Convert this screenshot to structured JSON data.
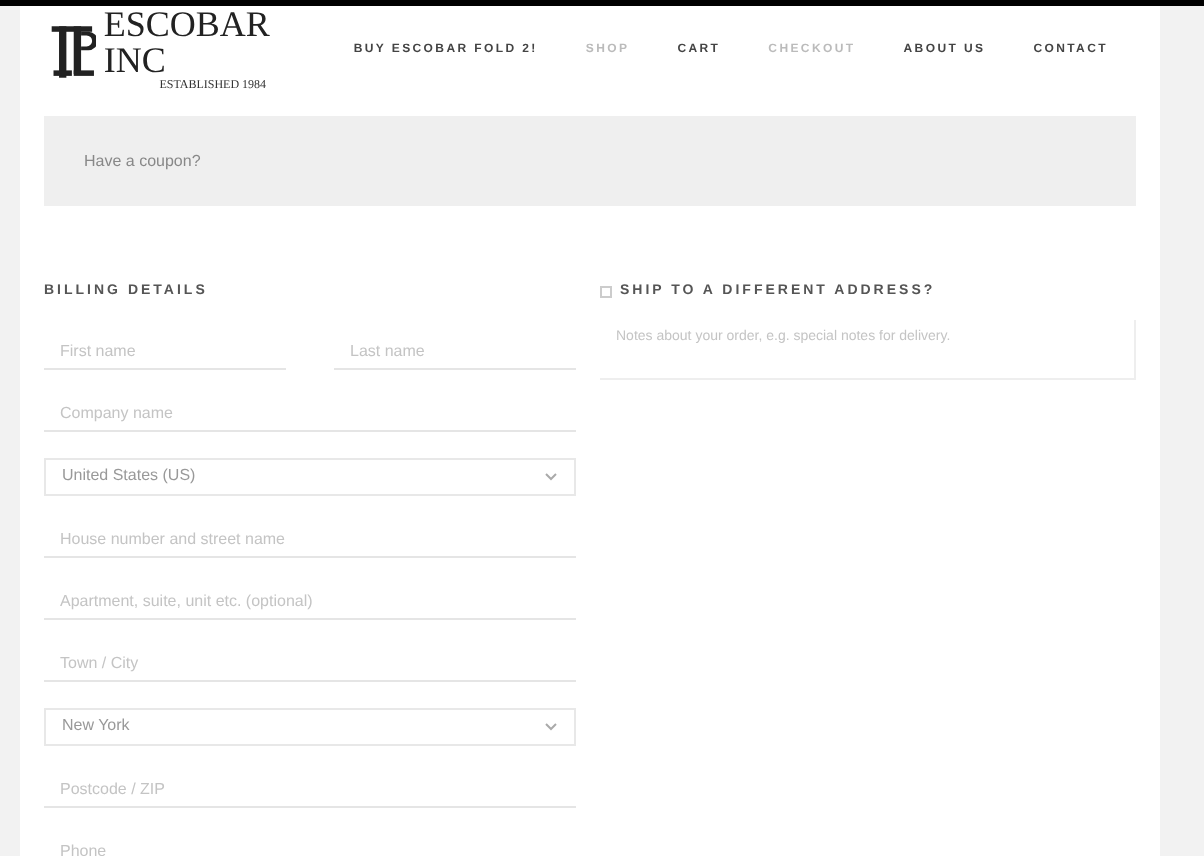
{
  "logo": {
    "name": "ESCOBAR INC",
    "tagline": "ESTABLISHED 1984"
  },
  "nav": [
    {
      "label": "BUY ESCOBAR FOLD 2!",
      "active": false
    },
    {
      "label": "SHOP",
      "active": true
    },
    {
      "label": "CART",
      "active": false
    },
    {
      "label": "CHECKOUT",
      "active": true
    },
    {
      "label": "ABOUT US",
      "active": false
    },
    {
      "label": "CONTACT",
      "active": false
    }
  ],
  "coupon": {
    "text": "Have a coupon?"
  },
  "billing": {
    "title": "BILLING DETAILS",
    "fields": [
      {
        "kind": "pair",
        "placeholders": [
          "First name",
          "Last name"
        ]
      },
      {
        "kind": "input",
        "placeholder": "Company name"
      },
      {
        "kind": "select",
        "value": "United States (US)"
      },
      {
        "kind": "input",
        "placeholder": "House number and street name"
      },
      {
        "kind": "input",
        "placeholder": "Apartment, suite, unit etc. (optional)"
      },
      {
        "kind": "input",
        "placeholder": "Town / City"
      },
      {
        "kind": "select",
        "value": "New York"
      },
      {
        "kind": "input",
        "placeholder": "Postcode / ZIP"
      },
      {
        "kind": "input",
        "placeholder": "Phone"
      }
    ]
  },
  "shipping": {
    "title": "SHIP TO A DIFFERENT ADDRESS?",
    "checked": false,
    "notes_placeholder": "Notes about your order, e.g. special notes for delivery."
  }
}
